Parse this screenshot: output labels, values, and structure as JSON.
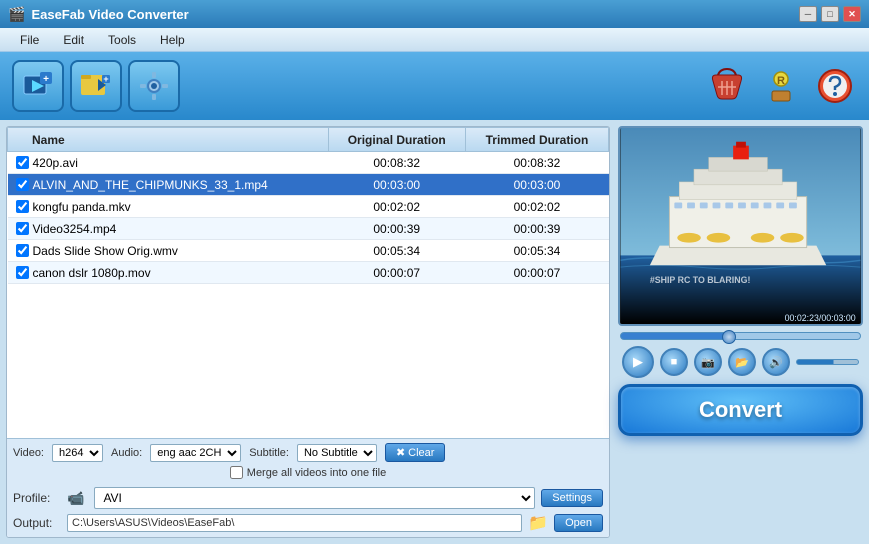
{
  "window": {
    "title": "EaseFab Video Converter",
    "icon": "🎬"
  },
  "titlebar": {
    "minimize_label": "─",
    "maximize_label": "□",
    "close_label": "✕"
  },
  "menu": {
    "items": [
      "File",
      "Edit",
      "Tools",
      "Help"
    ]
  },
  "toolbar": {
    "add_video_icon": "▶+",
    "add_folder_icon": "🎞",
    "settings_icon": "⚙",
    "basket_icon": "🛒",
    "register_icon": "🔑",
    "help_icon": "⛑"
  },
  "file_table": {
    "columns": [
      "Name",
      "Original Duration",
      "Trimmed Duration"
    ],
    "rows": [
      {
        "checked": true,
        "name": "420p.avi",
        "original": "00:08:32",
        "trimmed": "00:08:32",
        "selected": false
      },
      {
        "checked": true,
        "name": "ALVIN_AND_THE_CHIPMUNKS_33_1.mp4",
        "original": "00:03:00",
        "trimmed": "00:03:00",
        "selected": true
      },
      {
        "checked": true,
        "name": "kongfu panda.mkv",
        "original": "00:02:02",
        "trimmed": "00:02:02",
        "selected": false
      },
      {
        "checked": true,
        "name": "Video3254.mp4",
        "original": "00:00:39",
        "trimmed": "00:00:39",
        "selected": false
      },
      {
        "checked": true,
        "name": "Dads Slide Show Orig.wmv",
        "original": "00:05:34",
        "trimmed": "00:05:34",
        "selected": false
      },
      {
        "checked": true,
        "name": "canon dslr 1080p.mov",
        "original": "00:00:07",
        "trimmed": "00:00:07",
        "selected": false
      }
    ]
  },
  "bottom_controls": {
    "video_label": "Video:",
    "video_value": "h264",
    "audio_label": "Audio:",
    "audio_value": "eng aac 2CH",
    "subtitle_label": "Subtitle:",
    "subtitle_value": "No Subtitle",
    "clear_label": "Clear",
    "merge_label": "Merge all videos into one file",
    "profile_label": "Profile:",
    "profile_value": "AVI",
    "settings_label": "Settings",
    "output_label": "Output:",
    "output_path": "C:\\Users\\ASUS\\Videos\\EaseFab\\",
    "open_label": "Open"
  },
  "preview": {
    "watermark": "#SHIP RC TO BLARING!",
    "time_current": "00:02:23",
    "time_total": "00:03:00",
    "time_display": "00:02:23/00:03:00"
  },
  "convert": {
    "label": "Convert"
  }
}
